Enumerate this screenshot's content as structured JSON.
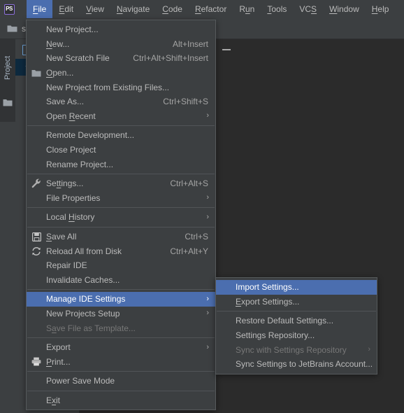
{
  "window": {
    "app_logo_text": "PS",
    "project_label": "st",
    "editor_background_color": "#2b2b2b",
    "panel_background_color": "#3c3f41",
    "accent_color": "#4b6eaf",
    "selected_tree_row_color": "#0d293e"
  },
  "toolwindow": {
    "stripe_tab_label": "Project",
    "stripe_folder_icon": "folder-icon",
    "tree_file_icon": "file-icon",
    "tree_chevron_icon": "chevron-down-icon",
    "tree_folder_icon": "folder-icon",
    "minimize_icon": "minimize-icon"
  },
  "menubar": {
    "items": [
      {
        "label": "File",
        "mnemonic": "F",
        "active": true
      },
      {
        "label": "Edit",
        "mnemonic": "E",
        "active": false
      },
      {
        "label": "View",
        "mnemonic": "V",
        "active": false
      },
      {
        "label": "Navigate",
        "mnemonic": "N",
        "active": false
      },
      {
        "label": "Code",
        "mnemonic": "C",
        "active": false
      },
      {
        "label": "Refactor",
        "mnemonic": "R",
        "active": false
      },
      {
        "label": "Run",
        "mnemonic": "u",
        "active": false
      },
      {
        "label": "Tools",
        "mnemonic": "T",
        "active": false
      },
      {
        "label": "VCS",
        "mnemonic": "S",
        "active": false
      },
      {
        "label": "Window",
        "mnemonic": "W",
        "active": false
      },
      {
        "label": "Help",
        "mnemonic": "H",
        "active": false
      }
    ]
  },
  "file_menu": {
    "items": [
      {
        "type": "item",
        "label": "New Project...",
        "accel": "",
        "icon": "",
        "arrow": false,
        "disabled": false,
        "selected": false
      },
      {
        "type": "item",
        "label": "New...",
        "mnemonic": "N",
        "accel": "Alt+Insert",
        "icon": "",
        "arrow": false,
        "disabled": false,
        "selected": false
      },
      {
        "type": "item",
        "label": "New Scratch File",
        "accel": "Ctrl+Alt+Shift+Insert",
        "icon": "",
        "arrow": false,
        "disabled": false,
        "selected": false
      },
      {
        "type": "item",
        "label": "Open...",
        "mnemonic": "O",
        "accel": "",
        "icon": "folder-icon",
        "arrow": false,
        "disabled": false,
        "selected": false
      },
      {
        "type": "item",
        "label": "New Project from Existing Files...",
        "accel": "",
        "icon": "",
        "arrow": false,
        "disabled": false,
        "selected": false
      },
      {
        "type": "item",
        "label": "Save As...",
        "accel": "Ctrl+Shift+S",
        "icon": "",
        "arrow": false,
        "disabled": false,
        "selected": false
      },
      {
        "type": "item",
        "label": "Open Recent",
        "mnemonic": "R",
        "accel": "",
        "icon": "",
        "arrow": true,
        "disabled": false,
        "selected": false
      },
      {
        "type": "separator"
      },
      {
        "type": "item",
        "label": "Remote Development...",
        "accel": "",
        "icon": "",
        "arrow": false,
        "disabled": false,
        "selected": false
      },
      {
        "type": "item",
        "label": "Close Project",
        "accel": "",
        "icon": "",
        "arrow": false,
        "disabled": false,
        "selected": false
      },
      {
        "type": "item",
        "label": "Rename Project...",
        "accel": "",
        "icon": "",
        "arrow": false,
        "disabled": false,
        "selected": false
      },
      {
        "type": "separator"
      },
      {
        "type": "item",
        "label": "Settings...",
        "mnemonic": "tt",
        "accel": "Ctrl+Alt+S",
        "icon": "wrench-icon",
        "arrow": false,
        "disabled": false,
        "selected": false
      },
      {
        "type": "item",
        "label": "File Properties",
        "accel": "",
        "icon": "",
        "arrow": true,
        "disabled": false,
        "selected": false
      },
      {
        "type": "separator"
      },
      {
        "type": "item",
        "label": "Local History",
        "mnemonic": "H",
        "accel": "",
        "icon": "",
        "arrow": true,
        "disabled": false,
        "selected": false
      },
      {
        "type": "separator"
      },
      {
        "type": "item",
        "label": "Save All",
        "mnemonic": "S",
        "accel": "Ctrl+S",
        "icon": "save-icon",
        "arrow": false,
        "disabled": false,
        "selected": false
      },
      {
        "type": "item",
        "label": "Reload All from Disk",
        "accel": "Ctrl+Alt+Y",
        "icon": "reload-icon",
        "arrow": false,
        "disabled": false,
        "selected": false
      },
      {
        "type": "item",
        "label": "Repair IDE",
        "accel": "",
        "icon": "",
        "arrow": false,
        "disabled": false,
        "selected": false
      },
      {
        "type": "item",
        "label": "Invalidate Caches...",
        "accel": "",
        "icon": "",
        "arrow": false,
        "disabled": false,
        "selected": false
      },
      {
        "type": "separator"
      },
      {
        "type": "item",
        "label": "Manage IDE Settings",
        "accel": "",
        "icon": "",
        "arrow": true,
        "disabled": false,
        "selected": true
      },
      {
        "type": "item",
        "label": "New Projects Setup",
        "accel": "",
        "icon": "",
        "arrow": true,
        "disabled": false,
        "selected": false
      },
      {
        "type": "item",
        "label": "Save File as Template...",
        "mnemonic": "a",
        "accel": "",
        "icon": "",
        "arrow": false,
        "disabled": true,
        "selected": false
      },
      {
        "type": "separator"
      },
      {
        "type": "item",
        "label": "Export",
        "accel": "",
        "icon": "",
        "arrow": true,
        "disabled": false,
        "selected": false
      },
      {
        "type": "item",
        "label": "Print...",
        "mnemonic": "P",
        "accel": "",
        "icon": "print-icon",
        "arrow": false,
        "disabled": false,
        "selected": false
      },
      {
        "type": "separator"
      },
      {
        "type": "item",
        "label": "Power Save Mode",
        "accel": "",
        "icon": "",
        "arrow": false,
        "disabled": false,
        "selected": false
      },
      {
        "type": "separator"
      },
      {
        "type": "item",
        "label": "Exit",
        "mnemonic": "x",
        "accel": "",
        "icon": "",
        "arrow": false,
        "disabled": false,
        "selected": false
      }
    ]
  },
  "manage_ide_settings_submenu": {
    "items": [
      {
        "type": "item",
        "label": "Import Settings...",
        "accel": "",
        "arrow": false,
        "disabled": false,
        "selected": true
      },
      {
        "type": "item",
        "label": "Export Settings...",
        "mnemonic": "E",
        "accel": "",
        "arrow": false,
        "disabled": false,
        "selected": false
      },
      {
        "type": "separator"
      },
      {
        "type": "item",
        "label": "Restore Default Settings...",
        "accel": "",
        "arrow": false,
        "disabled": false,
        "selected": false
      },
      {
        "type": "item",
        "label": "Settings Repository...",
        "accel": "",
        "arrow": false,
        "disabled": false,
        "selected": false
      },
      {
        "type": "item",
        "label": "Sync with Settings Repository",
        "accel": "",
        "arrow": true,
        "disabled": true,
        "selected": false
      },
      {
        "type": "item",
        "label": "Sync Settings to JetBrains Account...",
        "accel": "",
        "arrow": false,
        "disabled": false,
        "selected": false
      }
    ]
  }
}
